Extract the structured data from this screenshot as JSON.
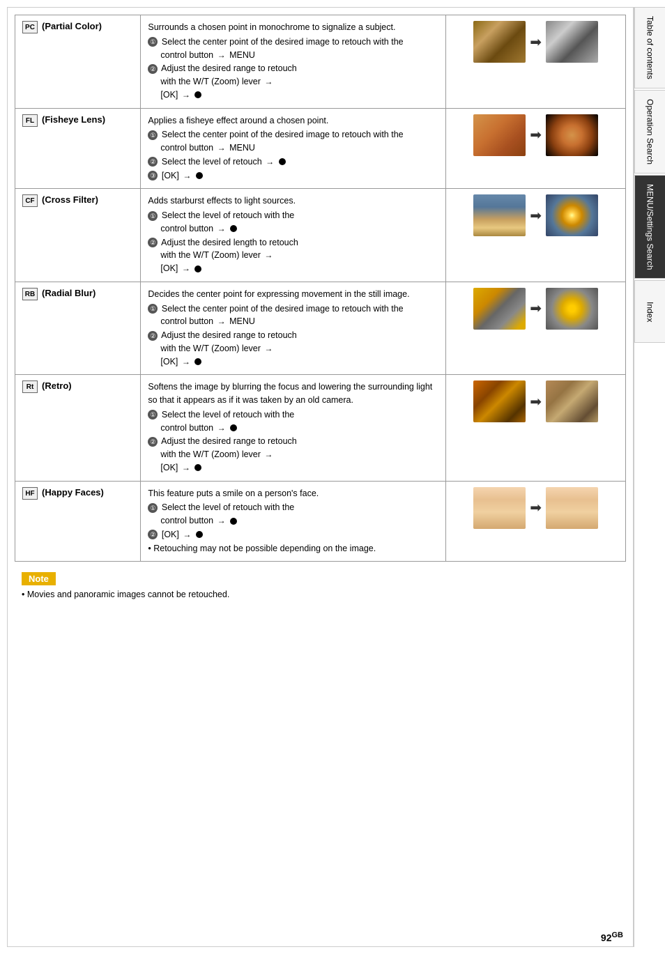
{
  "page": {
    "number": "92",
    "gb_label": "GB"
  },
  "sidebar": {
    "tabs": [
      {
        "label": "Table of contents",
        "active": false
      },
      {
        "label": "Operation Search",
        "active": false
      },
      {
        "label": "MENU/Settings Search",
        "active": false
      },
      {
        "label": "Index",
        "active": false
      }
    ]
  },
  "note": {
    "badge": "Note",
    "text": "• Movies and panoramic images cannot be retouched."
  },
  "features": [
    {
      "id": "partial-color",
      "name": "(Partial Color)",
      "description_intro": "Surrounds a chosen point in monochrome to signalize a subject.",
      "steps": [
        "Select the center point of the desired image to retouch with the control button → MENU",
        "Adjust the desired range to retouch with the W/T (Zoom) lever → [OK] → ●"
      ],
      "photo_before": "dog-color",
      "photo_after": "dog-bw"
    },
    {
      "id": "fisheye-lens",
      "name": "(Fisheye Lens)",
      "description_intro": "Applies a fisheye effect around a chosen point.",
      "steps": [
        "Select the center point of the desired image to retouch with the control button → MENU",
        "Select the level of retouch → ●",
        "[OK] → ●"
      ],
      "photo_before": "dog2-color",
      "photo_after": "dog2-fisheye"
    },
    {
      "id": "cross-filter",
      "name": "(Cross Filter)",
      "description_intro": "Adds starburst effects to light sources.",
      "steps": [
        "Select the level of retouch with the control button → ●",
        "Adjust the desired length to retouch with the W/T (Zoom) lever → [OK] → ●"
      ],
      "photo_before": "city-normal",
      "photo_after": "city-cross"
    },
    {
      "id": "radial-blur",
      "name": "(Radial Blur)",
      "description_intro": "Decides the center point for expressing movement in the still image.",
      "steps": [
        "Select the center point of the desired image to retouch with the control button → MENU",
        "Adjust the desired range to retouch with the W/T (Zoom) lever → [OK] → ●"
      ],
      "photo_before": "taxi-normal",
      "photo_after": "taxi-radial"
    },
    {
      "id": "retro",
      "name": "(Retro)",
      "description_intro": "Softens the image by blurring the focus and lowering the surrounding light so that it appears as if it was taken by an old camera.",
      "steps": [
        "Select the level of retouch with the control button → ●",
        "Adjust the desired range to retouch with the W/T (Zoom) lever → [OK] → ●"
      ],
      "photo_before": "lantern-normal",
      "photo_after": "lantern-retro"
    },
    {
      "id": "happy-faces",
      "name": "(Happy Faces)",
      "description_intro": "This feature puts a smile on a person's face.",
      "steps": [
        "Select the level of retouch with the control button → ●",
        "[OK] → ●",
        "• Retouching may not be possible depending on the image."
      ],
      "photo_before": "face-normal",
      "photo_after": "face-happy"
    }
  ]
}
